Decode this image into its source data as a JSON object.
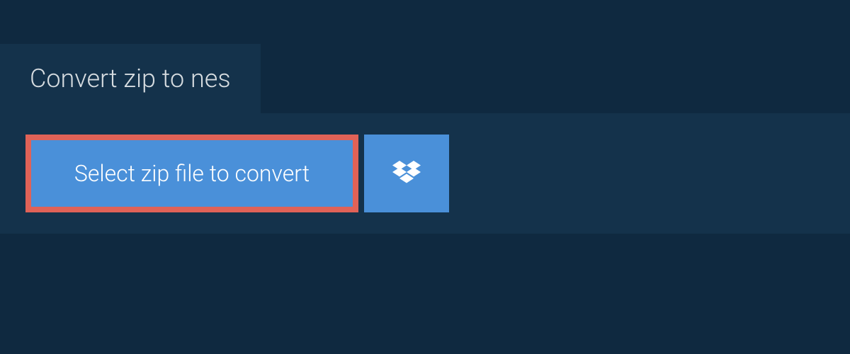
{
  "tab": {
    "title": "Convert zip to nes"
  },
  "actions": {
    "select_label": "Select zip file to convert"
  },
  "colors": {
    "page_bg": "#0f2940",
    "panel_bg": "#14324b",
    "button_bg": "#4a90d9",
    "highlight_border": "#e06257",
    "text_light": "#d6dce0",
    "text_white": "#ffffff"
  }
}
